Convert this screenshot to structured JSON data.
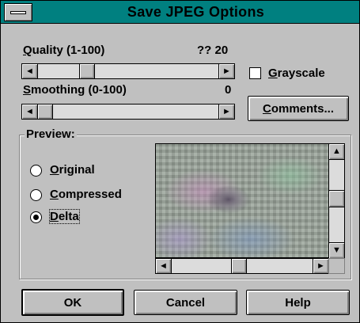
{
  "window": {
    "title": "Save JPEG Options"
  },
  "quality": {
    "label_key": "Q",
    "label_rest": "uality (1-100)",
    "value": "?? 20"
  },
  "smoothing": {
    "label_key": "S",
    "label_rest": "moothing (0-100)",
    "value": "0"
  },
  "grayscale": {
    "label_key": "G",
    "label_rest": "rayscale",
    "checked": false
  },
  "comments_button": {
    "label_key": "C",
    "label_rest": "omments..."
  },
  "preview": {
    "group_label": "Preview:",
    "options": [
      {
        "label_key": "O",
        "label_rest": "riginal",
        "selected": false
      },
      {
        "label_key": "C",
        "label_rest": "ompressed",
        "selected": false
      },
      {
        "label_key": "D",
        "label_rest": "elta",
        "selected": true
      }
    ]
  },
  "buttons": {
    "ok": "OK",
    "cancel": "Cancel",
    "help": "Help"
  },
  "icons": {
    "left_arrow": "◄",
    "right_arrow": "►",
    "up_arrow": "▲",
    "down_arrow": "▼"
  }
}
